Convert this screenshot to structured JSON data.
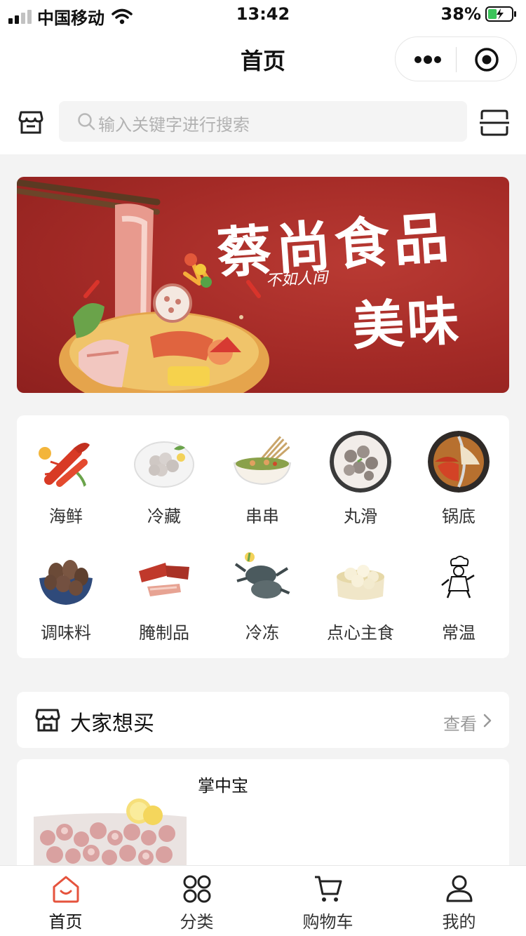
{
  "status_bar": {
    "carrier": "中国移动",
    "time": "13:42",
    "battery": "38%",
    "battery_level": 0.38
  },
  "header": {
    "title": "首页"
  },
  "search": {
    "placeholder": "输入关键字进行搜索"
  },
  "banner": {
    "title": "蔡尚食品",
    "subtitle": "不如人间",
    "tagline": "美味",
    "background_color": "#a52b27"
  },
  "categories": [
    {
      "label": "海鲜",
      "icon": "crayfish"
    },
    {
      "label": "冷藏",
      "icon": "shrimp-plate"
    },
    {
      "label": "串串",
      "icon": "skewers-bowl"
    },
    {
      "label": "丸滑",
      "icon": "meatballs"
    },
    {
      "label": "锅底",
      "icon": "hotpot"
    },
    {
      "label": "调味料",
      "icon": "spice-bowl"
    },
    {
      "label": "腌制品",
      "icon": "cured-meat"
    },
    {
      "label": "冷冻",
      "icon": "crab"
    },
    {
      "label": "点心主食",
      "icon": "dumplings"
    },
    {
      "label": "常温",
      "icon": "chef"
    }
  ],
  "section": {
    "title": "大家想买",
    "more": "查看"
  },
  "products": [
    {
      "name": "掌中宝"
    }
  ],
  "tabbar": {
    "items": [
      {
        "label": "首页",
        "icon": "home-icon",
        "active": true
      },
      {
        "label": "分类",
        "icon": "grid-icon",
        "active": false
      },
      {
        "label": "购物车",
        "icon": "cart-icon",
        "active": false
      },
      {
        "label": "我的",
        "icon": "user-icon",
        "active": false
      }
    ]
  },
  "colors": {
    "accent": "#e5533d",
    "text": "#222222",
    "muted": "#999999"
  }
}
